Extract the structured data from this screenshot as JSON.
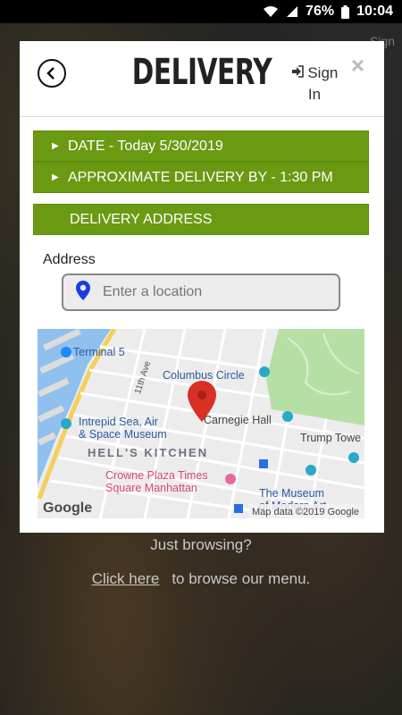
{
  "status": {
    "battery": "76%",
    "time": "10:04"
  },
  "background": {
    "faint_signin": "Sign",
    "browse_question": "Just browsing?",
    "click_here": "Click here",
    "browse_rest": "to browse our menu."
  },
  "modal": {
    "title": "DELIVERY",
    "signin_line1": "Sign",
    "signin_line2": "In",
    "close": "×",
    "date_bar": "DATE - Today 5/30/2019",
    "approx_bar": "APPROXIMATE DELIVERY BY - 1:30 PM",
    "address_bar": "DELIVERY ADDRESS",
    "address_label": "Address",
    "address_placeholder": "Enter a location"
  },
  "map": {
    "labels": {
      "terminal": "Terminal 5",
      "street": "11th Ave",
      "columbus": "Columbus Circle",
      "carnegie": "Carnegie Hall",
      "trump": "Trump Towe",
      "intrepid1": "Intrepid Sea, Air",
      "intrepid2": "& Space Museum",
      "hells": "HELL'S KITCHEN",
      "crowne1": "Crowne Plaza Times",
      "crowne2": "Square Manhattan",
      "museum1": "The Museum",
      "museum2": "of Modern Art",
      "google": "Google",
      "mapdata": "Map data ©2019 Google"
    }
  },
  "colors": {
    "accent_green": "#6a9a12",
    "pin_red": "#d93025",
    "pin_blue": "#1a3de0"
  }
}
